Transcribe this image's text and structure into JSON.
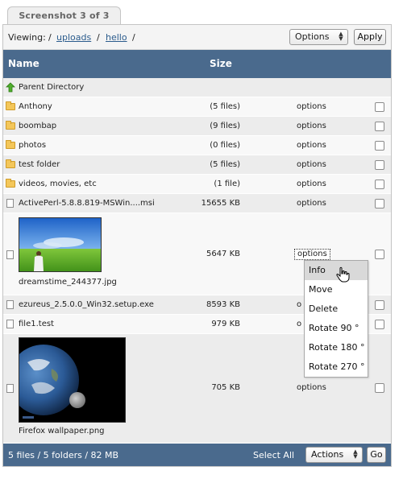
{
  "tab": {
    "title": "Screenshot 3 of 3"
  },
  "viewbar": {
    "label": "Viewing:",
    "sep": "/",
    "crumbs": [
      "uploads",
      "hello"
    ],
    "options_select": "Options",
    "apply_label": "Apply"
  },
  "table": {
    "col_name": "Name",
    "col_size": "Size",
    "parent": "Parent Directory",
    "rows": [
      {
        "name": "Anthony",
        "size": "(5 files)",
        "options": "options"
      },
      {
        "name": "boombap",
        "size": "(9 files)",
        "options": "options"
      },
      {
        "name": "photos",
        "size": "(0 files)",
        "options": "options"
      },
      {
        "name": "test folder",
        "size": "(5 files)",
        "options": "options"
      },
      {
        "name": "videos, movies, etc",
        "size": "(1 file)",
        "options": "options"
      },
      {
        "name": "ActivePerl-5.8.8.819-MSWin....msi",
        "size": "15655 KB",
        "options": "options"
      },
      {
        "name": "dreamstime_244377.jpg",
        "size": "5647 KB",
        "options": "options"
      },
      {
        "name": "ezureus_2.5.0.0_Win32.setup.exe",
        "size": "8593 KB",
        "options": "o"
      },
      {
        "name": "file1.test",
        "size": "979 KB",
        "options": "o"
      },
      {
        "name": "Firefox wallpaper.png",
        "size": "705 KB",
        "options": "options"
      }
    ]
  },
  "menu": {
    "items": [
      "Info",
      "Move",
      "Delete",
      "Rotate 90 °",
      "Rotate 180 °",
      "Rotate 270 °"
    ]
  },
  "footer": {
    "stats": "5 files / 5 folders / 82 MB",
    "select_all": "Select All",
    "actions_select": "Actions",
    "go_label": "Go"
  }
}
